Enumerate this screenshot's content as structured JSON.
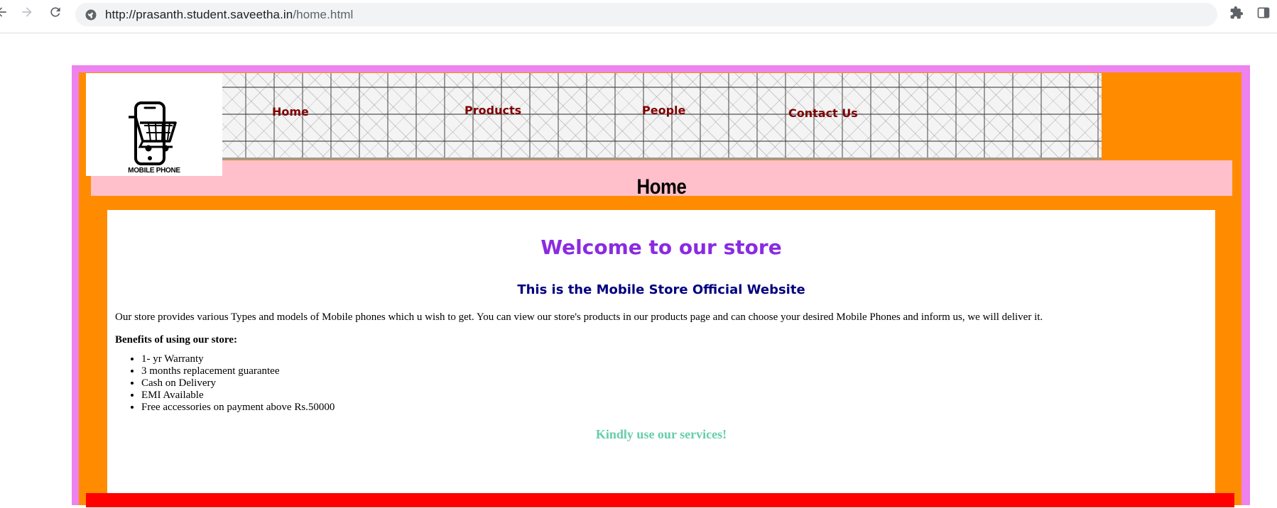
{
  "browser": {
    "url_host": "http://prasanth.student.saveetha.in",
    "url_path": "/home.html"
  },
  "header": {
    "logo_caption": "MOBILE PHONE",
    "nav": [
      "Home",
      "Products",
      "People",
      "Contact Us"
    ]
  },
  "page_title": "Home",
  "main": {
    "welcome": "Welcome to our store",
    "subtitle": "This is the Mobile Store Official Website",
    "description": "Our store provides various Types and models of Mobile phones which u wish to get. You can view our store's products in our products page and can choose your desired Mobile Phones and inform us, we will deliver it.",
    "benefits_label": "Benefits of using our store:",
    "benefits": [
      "1- yr Warranty",
      "3 months replacement guarantee",
      "Cash on Delivery",
      "EMI Available",
      "Free accessories on payment above Rs.50000"
    ],
    "closing": "Kindly use our services!"
  },
  "colors": {
    "outer_border": "#ee82ee",
    "frame": "#ff8c00",
    "title_bar": "#ffc0cb",
    "nav_link": "#800000",
    "welcome": "#8a2be2",
    "subtitle": "#000080",
    "closing": "#66cdaa",
    "footer": "#ff0000"
  },
  "icons": [
    "back-icon",
    "forward-icon",
    "reload-icon",
    "site-info-icon",
    "extensions-icon",
    "side-panel-icon",
    "phone-cart-icon"
  ]
}
